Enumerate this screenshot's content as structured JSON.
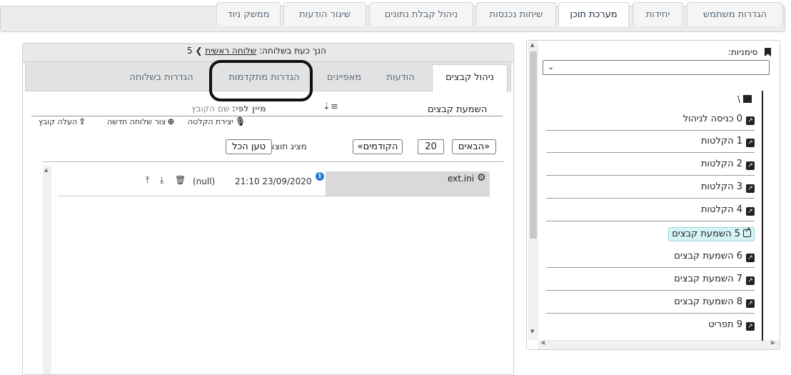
{
  "main_tabs": [
    {
      "label": "הגדרות משתמש"
    },
    {
      "label": "יחידות"
    },
    {
      "label": "מערכת תוכן",
      "active": true
    },
    {
      "label": "שיחות נכנסות"
    },
    {
      "label": "ניהול קבלת נתונים"
    },
    {
      "label": "שיגור הודעות"
    },
    {
      "label": "ממשק ניוד"
    }
  ],
  "sidebar": {
    "bookmarks_label": "סימניות:",
    "bookmarks_select_value": "",
    "root_label": "\\",
    "nodes": [
      {
        "label": "0 כניסה לניהול"
      },
      {
        "label": "1 הקלטות"
      },
      {
        "label": "2 הקלטות"
      },
      {
        "label": "3 הקלטות"
      },
      {
        "label": "4 הקלטות"
      },
      {
        "label": "5 השמעת קבצים",
        "selected": true
      },
      {
        "label": "6 השמעת קבצים"
      },
      {
        "label": "7 השמעת קבצים"
      },
      {
        "label": "8 השמעת קבצים"
      },
      {
        "label": "9 תפריט"
      }
    ]
  },
  "center": {
    "breadcrumb_prefix": "הנך כעת בשלוחה:",
    "breadcrumb_root": "שלוחה ראשית",
    "breadcrumb_sep": "❯",
    "breadcrumb_current": "5",
    "subtabs": [
      {
        "label": "ניהול קבצים",
        "active": true
      },
      {
        "label": "הודעות"
      },
      {
        "label": "מאפיינים"
      },
      {
        "label": "הגדרות מתקדמות"
      },
      {
        "label": "הגדרות בשלוחה"
      }
    ],
    "files_title": "השמעת קבצים",
    "sort_label": "מיין לפי:",
    "sort_value": "שם הקובץ",
    "tools": {
      "create_recording": "יצירת הקלטה",
      "create_extension": "צור שלוחה חדשה",
      "upload_file": "העלה קובץ"
    },
    "pager": {
      "next": "«הבאים",
      "count": "20",
      "prev": "הקודמים»",
      "results": "מציג תוצאות:0-0",
      "load_all": "טען הכל"
    },
    "files": [
      {
        "name": "ext.ini",
        "datetime": "21:10 23/09/2020",
        "size": "(null)"
      }
    ]
  },
  "colors": {
    "accent_selected": "#d6f4f6",
    "info_blue": "#2a7ad9"
  }
}
